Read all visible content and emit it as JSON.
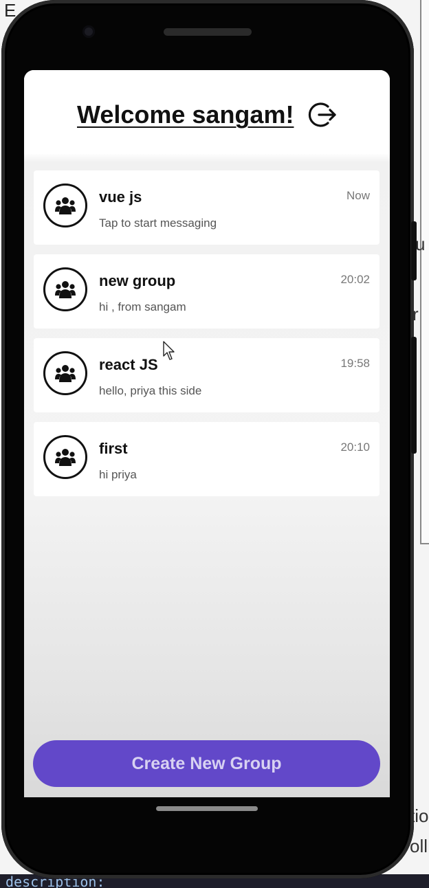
{
  "background": {
    "top_left_text": "E",
    "right_fragments": [
      "u",
      "r",
      "tio",
      "oll"
    ],
    "bottom_code": "description:"
  },
  "app": {
    "title": "Welcome sangam!",
    "logout_icon": "logout-icon",
    "chats": [
      {
        "name": "vue js",
        "time": "Now",
        "last_message": "Tap to start messaging",
        "icon": "group-icon"
      },
      {
        "name": "new group",
        "time": "20:02",
        "last_message": "hi , from sangam",
        "icon": "group-icon"
      },
      {
        "name": "react JS",
        "time": "19:58",
        "last_message": "hello, priya this side",
        "icon": "group-icon"
      },
      {
        "name": "first",
        "time": "20:10",
        "last_message": "hi priya",
        "icon": "group-icon"
      }
    ],
    "create_button_label": "Create New Group"
  },
  "colors": {
    "accent": "#6248c9",
    "button_text": "#d8d2f2",
    "phone_frame": "#050505"
  }
}
